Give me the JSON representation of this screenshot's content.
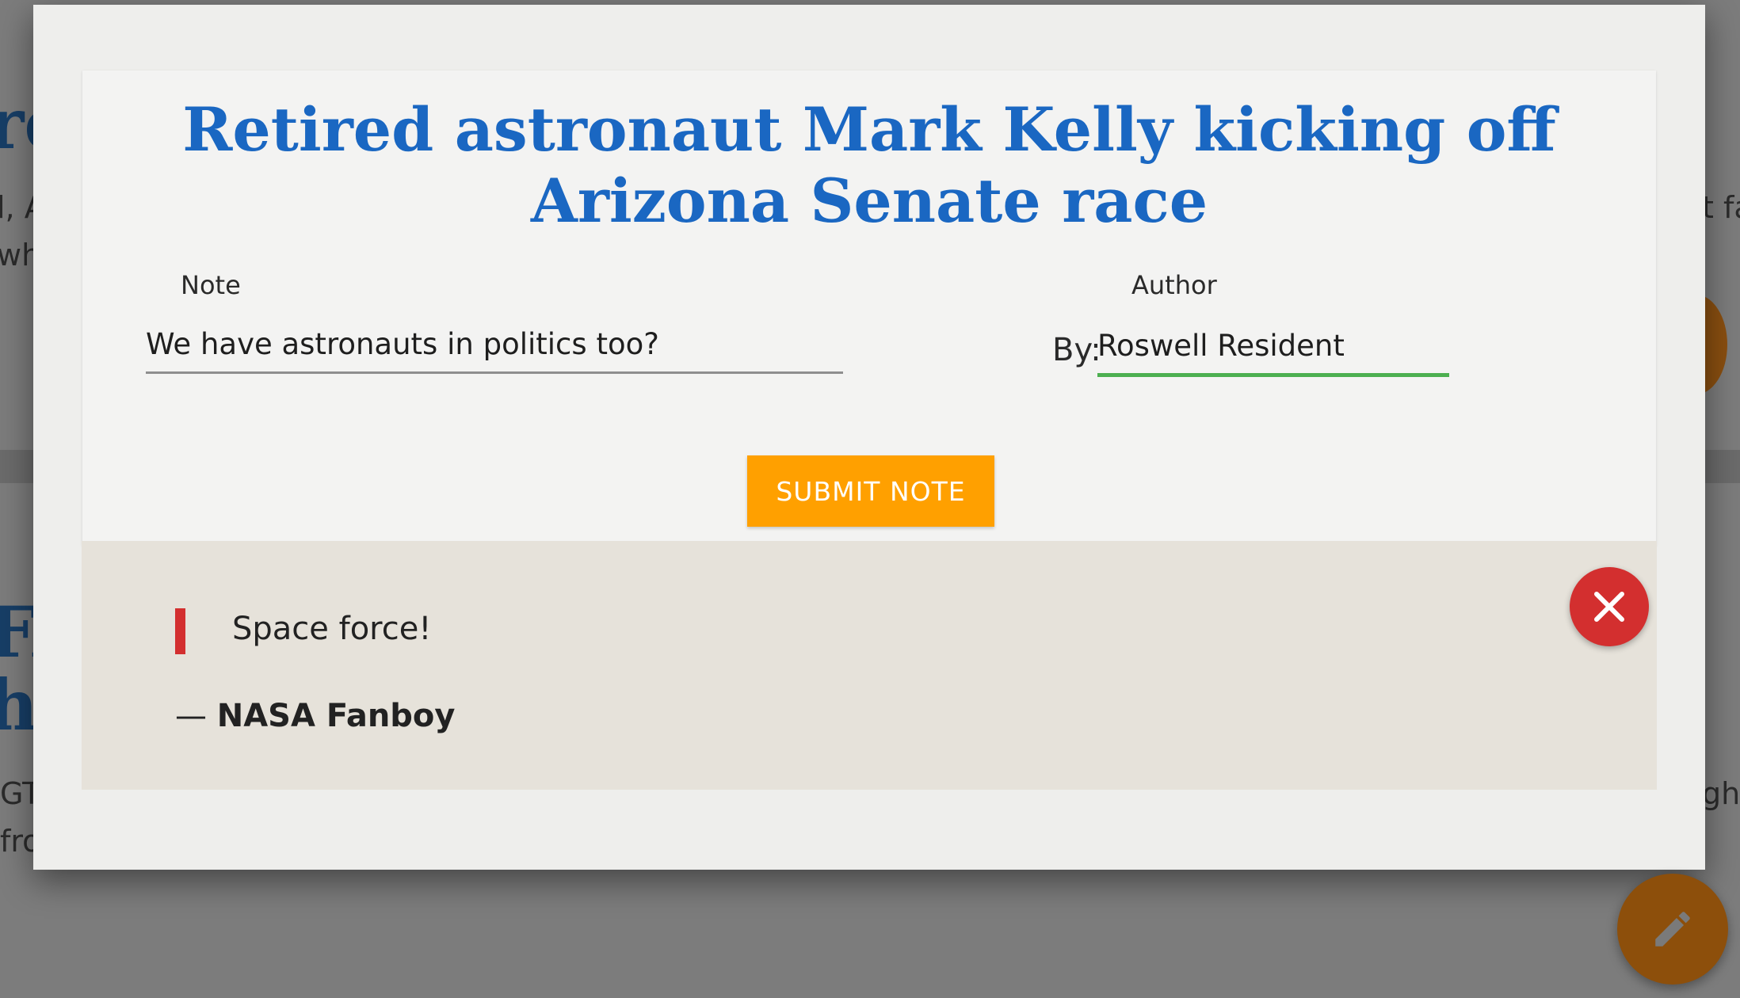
{
  "background": {
    "fragments": [
      {
        "text": "re"
      },
      {
        "text": "l, A"
      },
      {
        "text": "wh"
      },
      {
        "text": "t fa"
      },
      {
        "text": "FA"
      },
      {
        "text": "hi"
      },
      {
        "text": "GT"
      },
      {
        "text": "fro"
      },
      {
        "text": "gh"
      }
    ],
    "edit_fab_icon": "pencil-icon"
  },
  "modal": {
    "article": {
      "title": "Retired astronaut Mark Kelly kicking off Arizona Senate race"
    },
    "form": {
      "note_label": "Note",
      "note_value": "We have astronauts in politics too?",
      "author_label": "Author",
      "author_prefix": "By:",
      "author_value": "Roswell Resident",
      "submit_label": "SUBMIT NOTE"
    },
    "saved_note": {
      "text": "Space force!",
      "dash": "—",
      "author": "NASA Fanboy",
      "delete_icon": "close-icon"
    }
  },
  "colors": {
    "title": "#1a67c2",
    "submit_button": "#ffa000",
    "active_underline": "#4caf50",
    "accent_red": "#d32f2f",
    "edit_fab": "#8d4f0b"
  }
}
